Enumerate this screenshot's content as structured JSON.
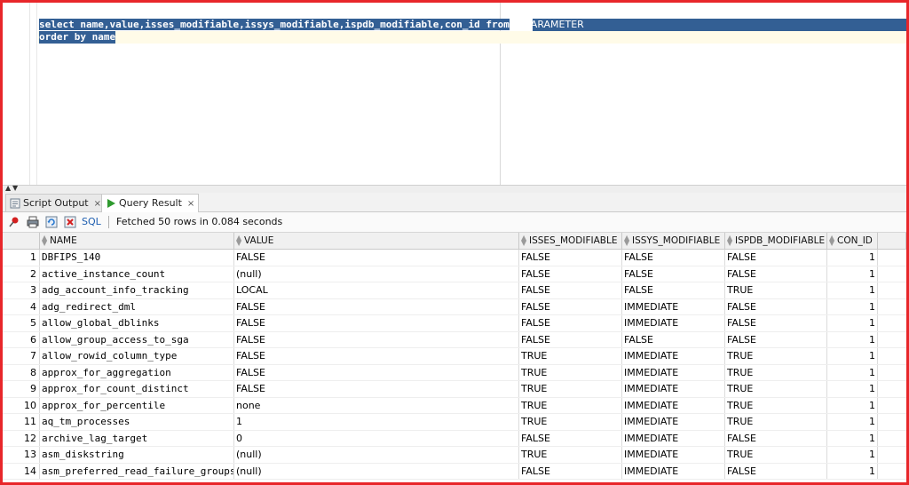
{
  "editor": {
    "line1": {
      "kw_select": "select",
      "columns": " name,value,isses_modifiable,issys_modifiable,ispdb_modifiable,con_id ",
      "kw_from": "from",
      "object": " V$PARAMETER"
    },
    "line2": {
      "kw_order": "order by",
      "rest": " name"
    }
  },
  "tabs": [
    {
      "label": "Script Output",
      "close": "×"
    },
    {
      "label": "Query Result",
      "close": "×"
    }
  ],
  "toolbar": {
    "sql_label": "SQL",
    "status": "Fetched 50 rows in 0.084 seconds"
  },
  "grid": {
    "columns": [
      "NAME",
      "VALUE",
      "ISSES_MODIFIABLE",
      "ISSYS_MODIFIABLE",
      "ISPDB_MODIFIABLE",
      "CON_ID"
    ],
    "rows": [
      {
        "n": "1",
        "name": "DBFIPS_140",
        "value": "FALSE",
        "isses": "FALSE",
        "issys": "FALSE",
        "ispdb": "FALSE",
        "con": "1"
      },
      {
        "n": "2",
        "name": "active_instance_count",
        "value": "(null)",
        "isses": "FALSE",
        "issys": "FALSE",
        "ispdb": "FALSE",
        "con": "1"
      },
      {
        "n": "3",
        "name": "adg_account_info_tracking",
        "value": "LOCAL",
        "isses": "FALSE",
        "issys": "FALSE",
        "ispdb": "TRUE",
        "con": "1"
      },
      {
        "n": "4",
        "name": "adg_redirect_dml",
        "value": "FALSE",
        "isses": "FALSE",
        "issys": "IMMEDIATE",
        "ispdb": "FALSE",
        "con": "1"
      },
      {
        "n": "5",
        "name": "allow_global_dblinks",
        "value": "FALSE",
        "isses": "FALSE",
        "issys": "IMMEDIATE",
        "ispdb": "FALSE",
        "con": "1"
      },
      {
        "n": "6",
        "name": "allow_group_access_to_sga",
        "value": "FALSE",
        "isses": "FALSE",
        "issys": "FALSE",
        "ispdb": "FALSE",
        "con": "1"
      },
      {
        "n": "7",
        "name": "allow_rowid_column_type",
        "value": "FALSE",
        "isses": "TRUE",
        "issys": "IMMEDIATE",
        "ispdb": "TRUE",
        "con": "1"
      },
      {
        "n": "8",
        "name": "approx_for_aggregation",
        "value": "FALSE",
        "isses": "TRUE",
        "issys": "IMMEDIATE",
        "ispdb": "TRUE",
        "con": "1"
      },
      {
        "n": "9",
        "name": "approx_for_count_distinct",
        "value": "FALSE",
        "isses": "TRUE",
        "issys": "IMMEDIATE",
        "ispdb": "TRUE",
        "con": "1"
      },
      {
        "n": "10",
        "name": "approx_for_percentile",
        "value": "none",
        "isses": "TRUE",
        "issys": "IMMEDIATE",
        "ispdb": "TRUE",
        "con": "1"
      },
      {
        "n": "11",
        "name": "aq_tm_processes",
        "value": "1",
        "isses": "TRUE",
        "issys": "IMMEDIATE",
        "ispdb": "TRUE",
        "con": "1"
      },
      {
        "n": "12",
        "name": "archive_lag_target",
        "value": "0",
        "isses": "FALSE",
        "issys": "IMMEDIATE",
        "ispdb": "FALSE",
        "con": "1"
      },
      {
        "n": "13",
        "name": "asm_diskstring",
        "value": "(null)",
        "isses": "TRUE",
        "issys": "IMMEDIATE",
        "ispdb": "TRUE",
        "con": "1"
      },
      {
        "n": "14",
        "name": "asm_preferred_read_failure_groups",
        "value": "(null)",
        "isses": "FALSE",
        "issys": "IMMEDIATE",
        "ispdb": "FALSE",
        "con": "1"
      }
    ]
  },
  "colors": {
    "frame": "#e8262a",
    "selection": "#335f94",
    "sql_link": "#1f5fb0"
  }
}
